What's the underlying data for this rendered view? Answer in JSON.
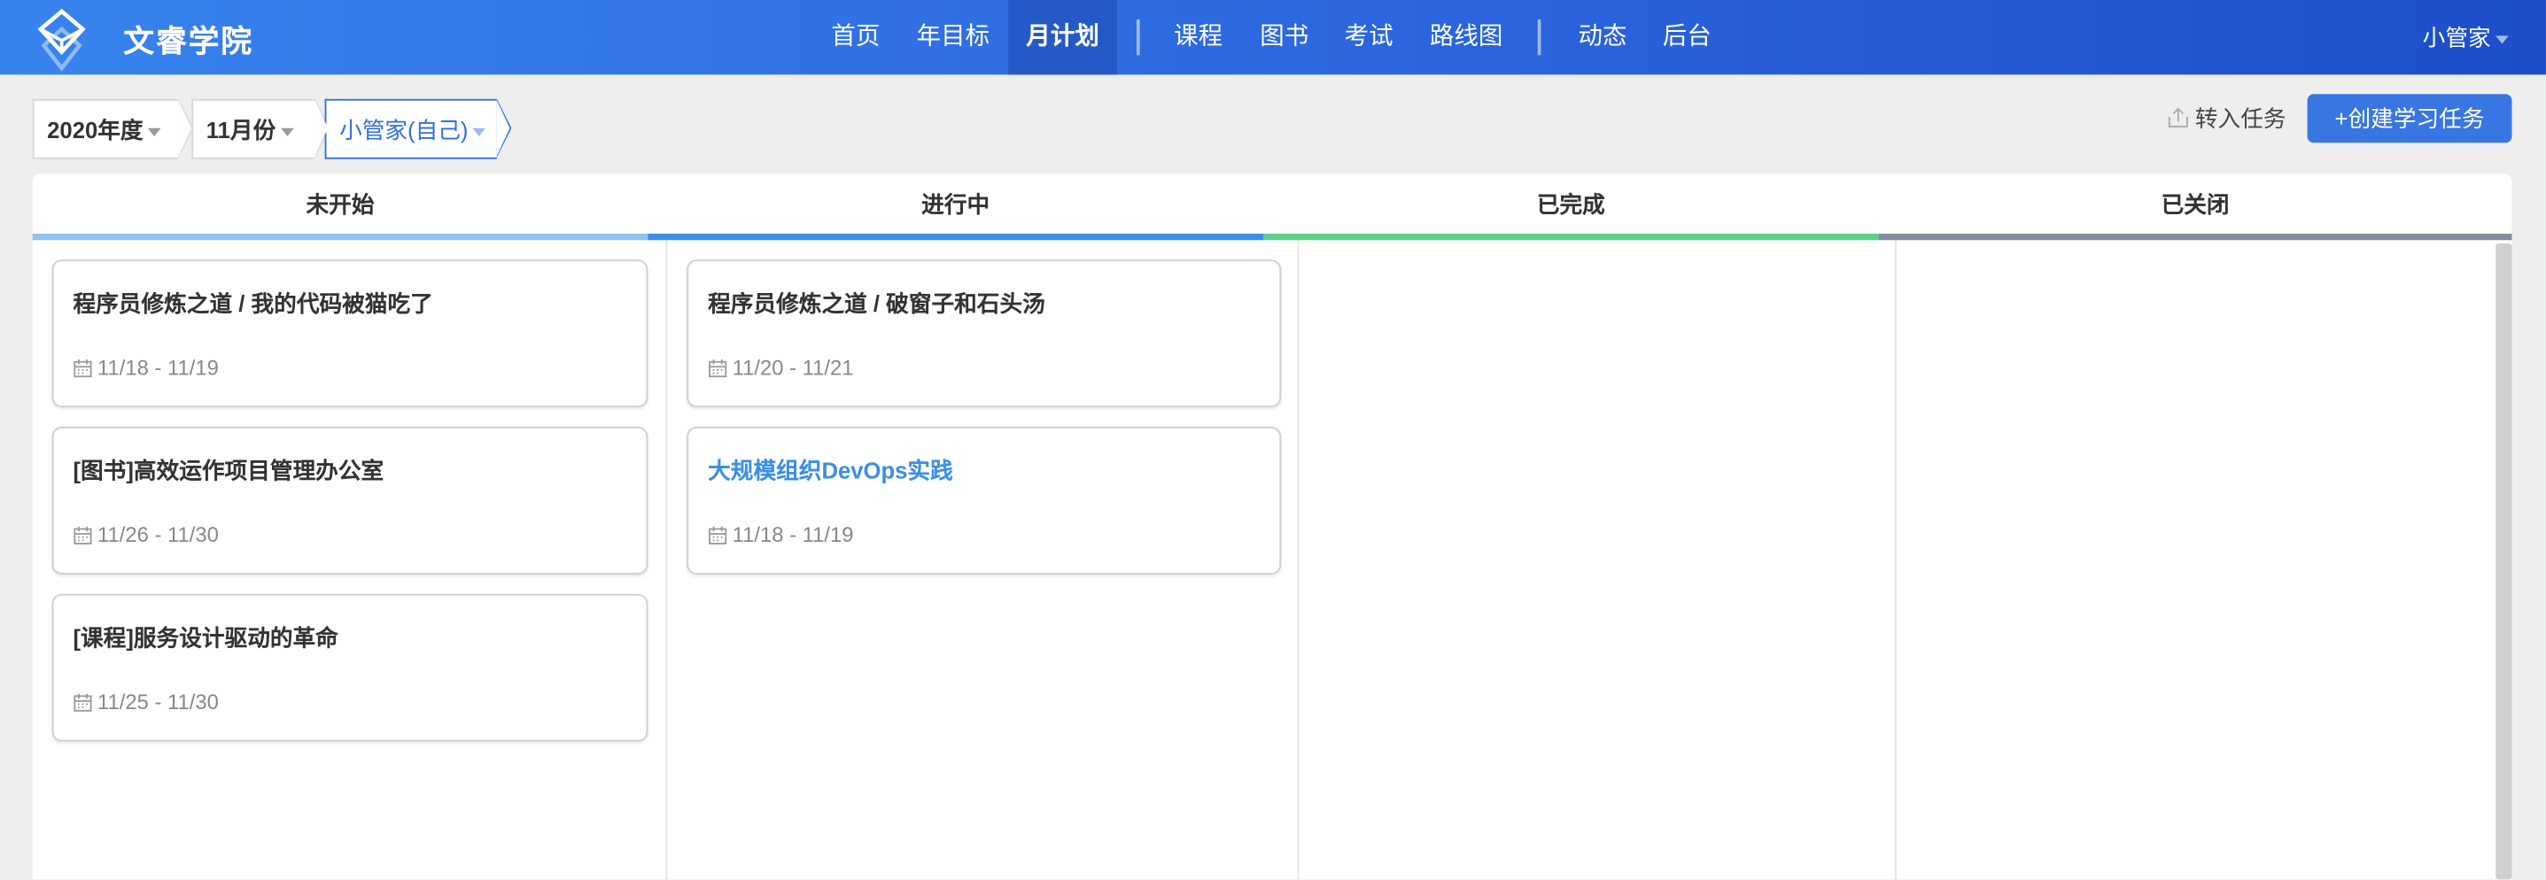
{
  "header": {
    "brand": "文睿学院",
    "nav": [
      "首页",
      "年目标",
      "月计划",
      "课程",
      "图书",
      "考试",
      "路线图",
      "动态",
      "后台"
    ],
    "active": "月计划",
    "user": "小管家"
  },
  "filters": {
    "year": "2020年度",
    "month": "11月份",
    "person": "小管家(自己)"
  },
  "actions": {
    "import": "转入任务",
    "create": "+创建学习任务"
  },
  "colors": {
    "not_started": "#8ec3f5",
    "in_progress": "#3b8fe8",
    "done": "#5fd08a",
    "closed": "#868c9c"
  },
  "columns": [
    {
      "title": "未开始",
      "cards": [
        {
          "title": "程序员修炼之道 / 我的代码被猫吃了",
          "date": "11/18 - 11/19"
        },
        {
          "title": "[图书]高效运作项目管理办公室",
          "date": "11/26 - 11/30"
        },
        {
          "title": "[课程]服务设计驱动的革命",
          "date": "11/25 - 11/30"
        }
      ]
    },
    {
      "title": "进行中",
      "cards": [
        {
          "title": "程序员修炼之道 / 破窗子和石头汤",
          "date": "11/20 - 11/21"
        },
        {
          "title": "大规模组织DevOps实践",
          "date": "11/18 - 11/19"
        }
      ]
    },
    {
      "title": "已完成",
      "cards": []
    },
    {
      "title": "已关闭",
      "cards": []
    }
  ]
}
